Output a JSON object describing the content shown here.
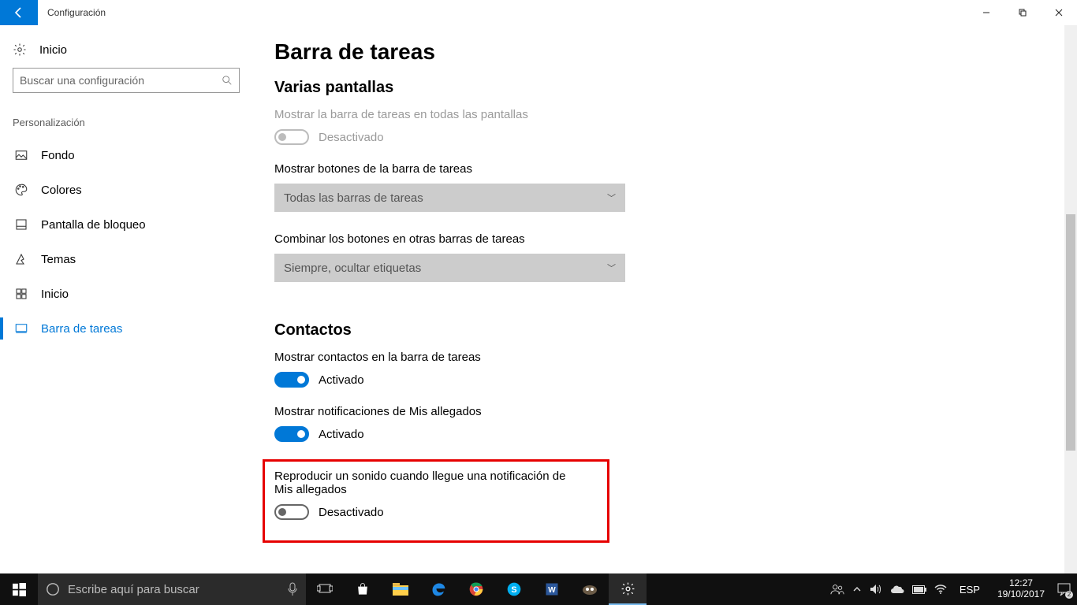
{
  "titlebar": {
    "app": "Configuración"
  },
  "sidebar": {
    "home": "Inicio",
    "search_placeholder": "Buscar una configuración",
    "section": "Personalización",
    "items": [
      {
        "label": "Fondo"
      },
      {
        "label": "Colores"
      },
      {
        "label": "Pantalla de bloqueo"
      },
      {
        "label": "Temas"
      },
      {
        "label": "Inicio"
      },
      {
        "label": "Barra de tareas"
      }
    ]
  },
  "main": {
    "title": "Barra de tareas",
    "section_multi": "Varias pantallas",
    "s_show_all": "Mostrar la barra de tareas en todas las pantallas",
    "off": "Desactivado",
    "on": "Activado",
    "s_show_buttons": "Mostrar botones de la barra de tareas",
    "dd_buttons": "Todas las barras de tareas",
    "s_combine": "Combinar los botones en otras barras de tareas",
    "dd_combine": "Siempre, ocultar etiquetas",
    "section_contacts": "Contactos",
    "s_contacts_show": "Mostrar contactos en la barra de tareas",
    "s_contacts_notif": "Mostrar notificaciones de Mis allegados",
    "s_contacts_sound": "Reproducir un sonido cuando llegue una notificación de Mis allegados"
  },
  "taskbar": {
    "search_placeholder": "Escribe aquí para buscar",
    "lang": "ESP",
    "time": "12:27",
    "date": "19/10/2017"
  }
}
